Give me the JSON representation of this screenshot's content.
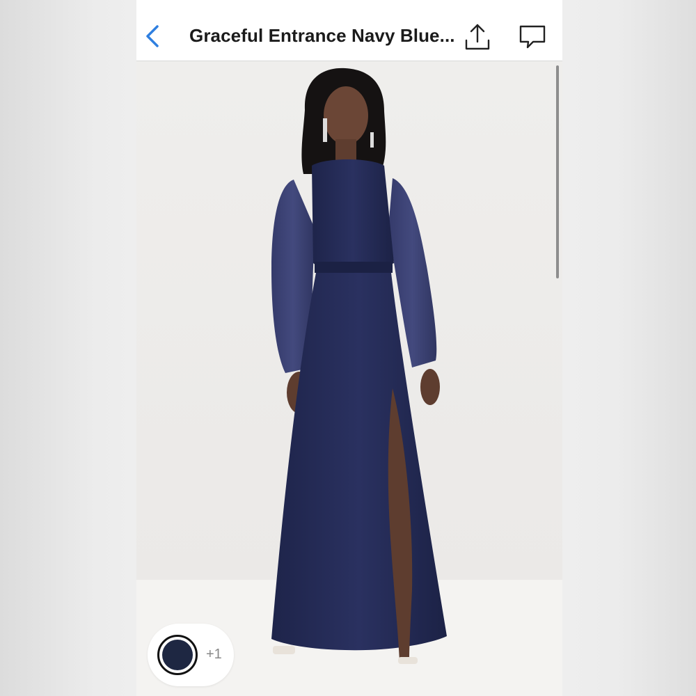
{
  "header": {
    "title": "Graceful Entrance Navy Blue...",
    "back_icon": "chevron-left-icon",
    "share_icon": "share-icon",
    "chat_icon": "chat-bubble-icon",
    "accent_color": "#2f7fe0"
  },
  "product_image": {
    "description_color": "#24294f"
  },
  "color_selector": {
    "selected_color": "#1e2742",
    "more_label": "+1"
  },
  "scroll_position": 0.0
}
